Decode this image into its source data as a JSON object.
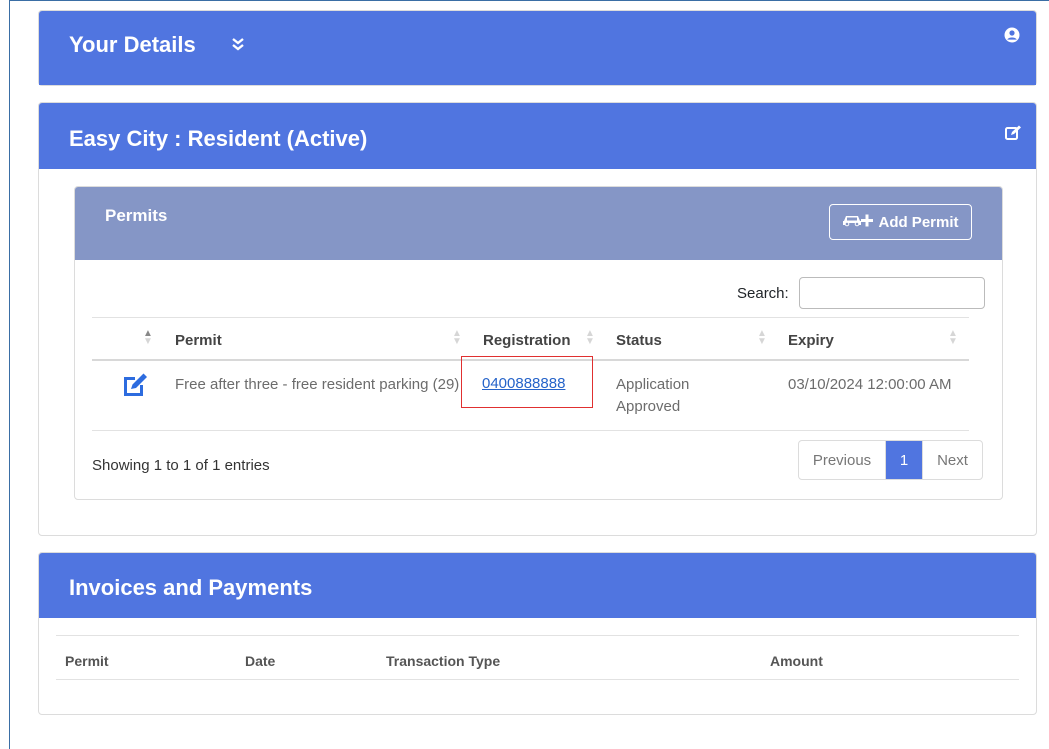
{
  "details": {
    "title": "Your Details",
    "chevron_icon": "double-chevron-down-icon",
    "user_icon": "user-circle-icon"
  },
  "account": {
    "title": "Easy City : Resident (Active)",
    "edit_icon": "edit-icon"
  },
  "permits": {
    "title": "Permits",
    "add_button_label": "Add Permit",
    "add_button_icon": "car-plus-icon",
    "search_label": "Search:",
    "search_value": "",
    "columns": [
      "Permit",
      "Registration",
      "Status",
      "Expiry"
    ],
    "rows": [
      {
        "permit": "Free after three - free resident parking (29)",
        "registration": "0400888888",
        "status": "Application Approved",
        "expiry": "03/10/2024 12:00:00 AM"
      }
    ],
    "showing": "Showing 1 to 1 of 1 entries",
    "pagination": {
      "previous": "Previous",
      "current": "1",
      "next": "Next"
    }
  },
  "invoices": {
    "title": "Invoices and Payments",
    "columns": [
      "Permit",
      "Date",
      "Transaction Type",
      "Amount"
    ]
  },
  "colors": {
    "header_blue": "#5075e0",
    "panel_header": "#8596c6",
    "link": "#2563c9",
    "highlight_box": "#e03030"
  }
}
